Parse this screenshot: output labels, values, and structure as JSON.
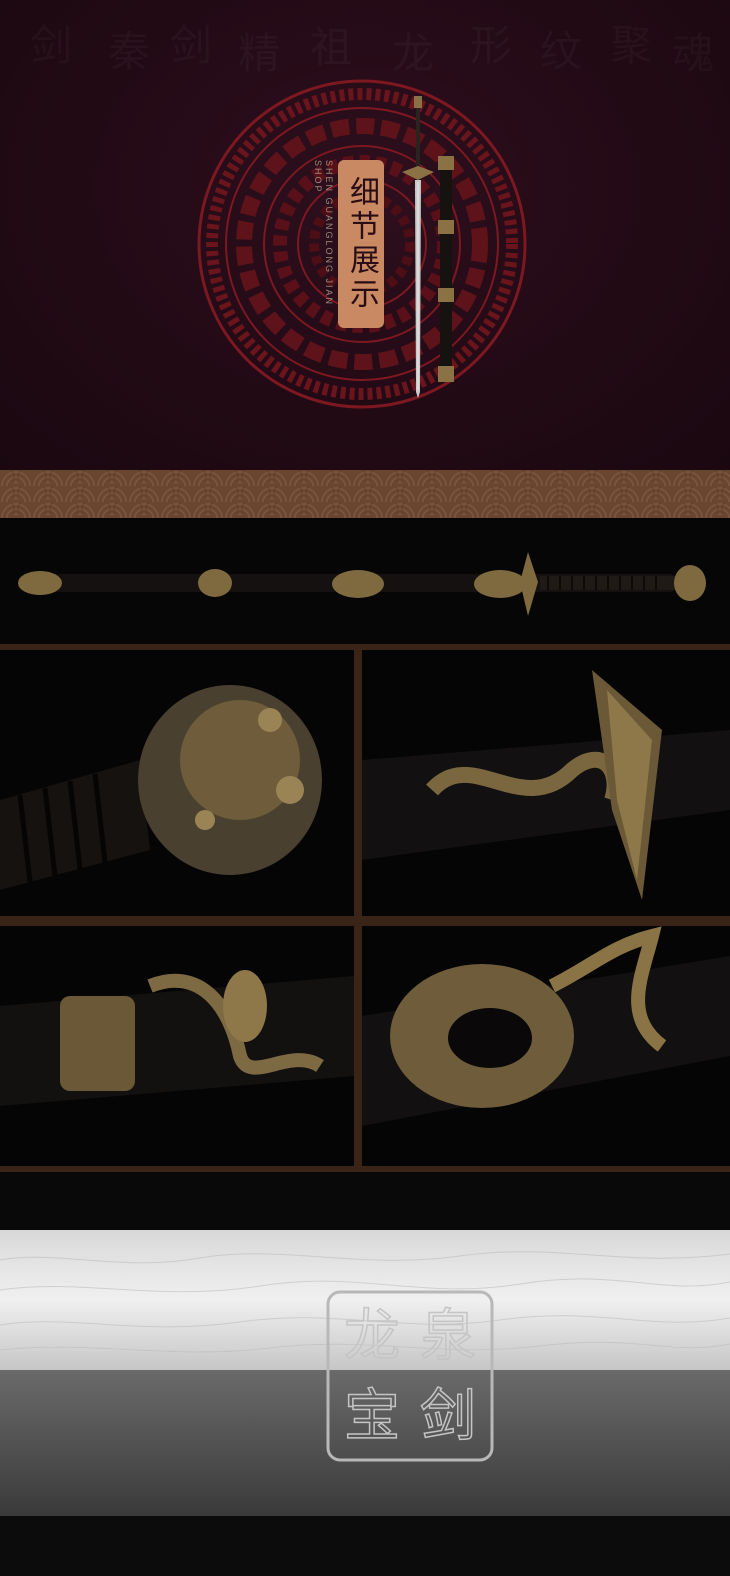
{
  "hero": {
    "title": "细节展示",
    "subtitle_line1": "SHEN GUANGLONG",
    "subtitle_line2": "JIAN SHOP",
    "bg_chars": [
      "剑",
      "秦",
      "剑",
      "精",
      "祖",
      "龙",
      "形",
      "纹",
      "聚",
      "魂"
    ]
  },
  "blade": {
    "seal_chars": "龙泉宝剑"
  },
  "colors": {
    "hero_bg": "#220a15",
    "medallion_red": "#8a1a22",
    "badge": "#c98a63",
    "banner": "#6a4631",
    "frame": "#3a2418",
    "brass": "#8a7244"
  },
  "images": [
    "full-sword-panorama",
    "pommel-detail",
    "guard-dragon-detail",
    "scabbard-crane-detail",
    "scabbard-tip-detail",
    "blade-seal-detail"
  ]
}
